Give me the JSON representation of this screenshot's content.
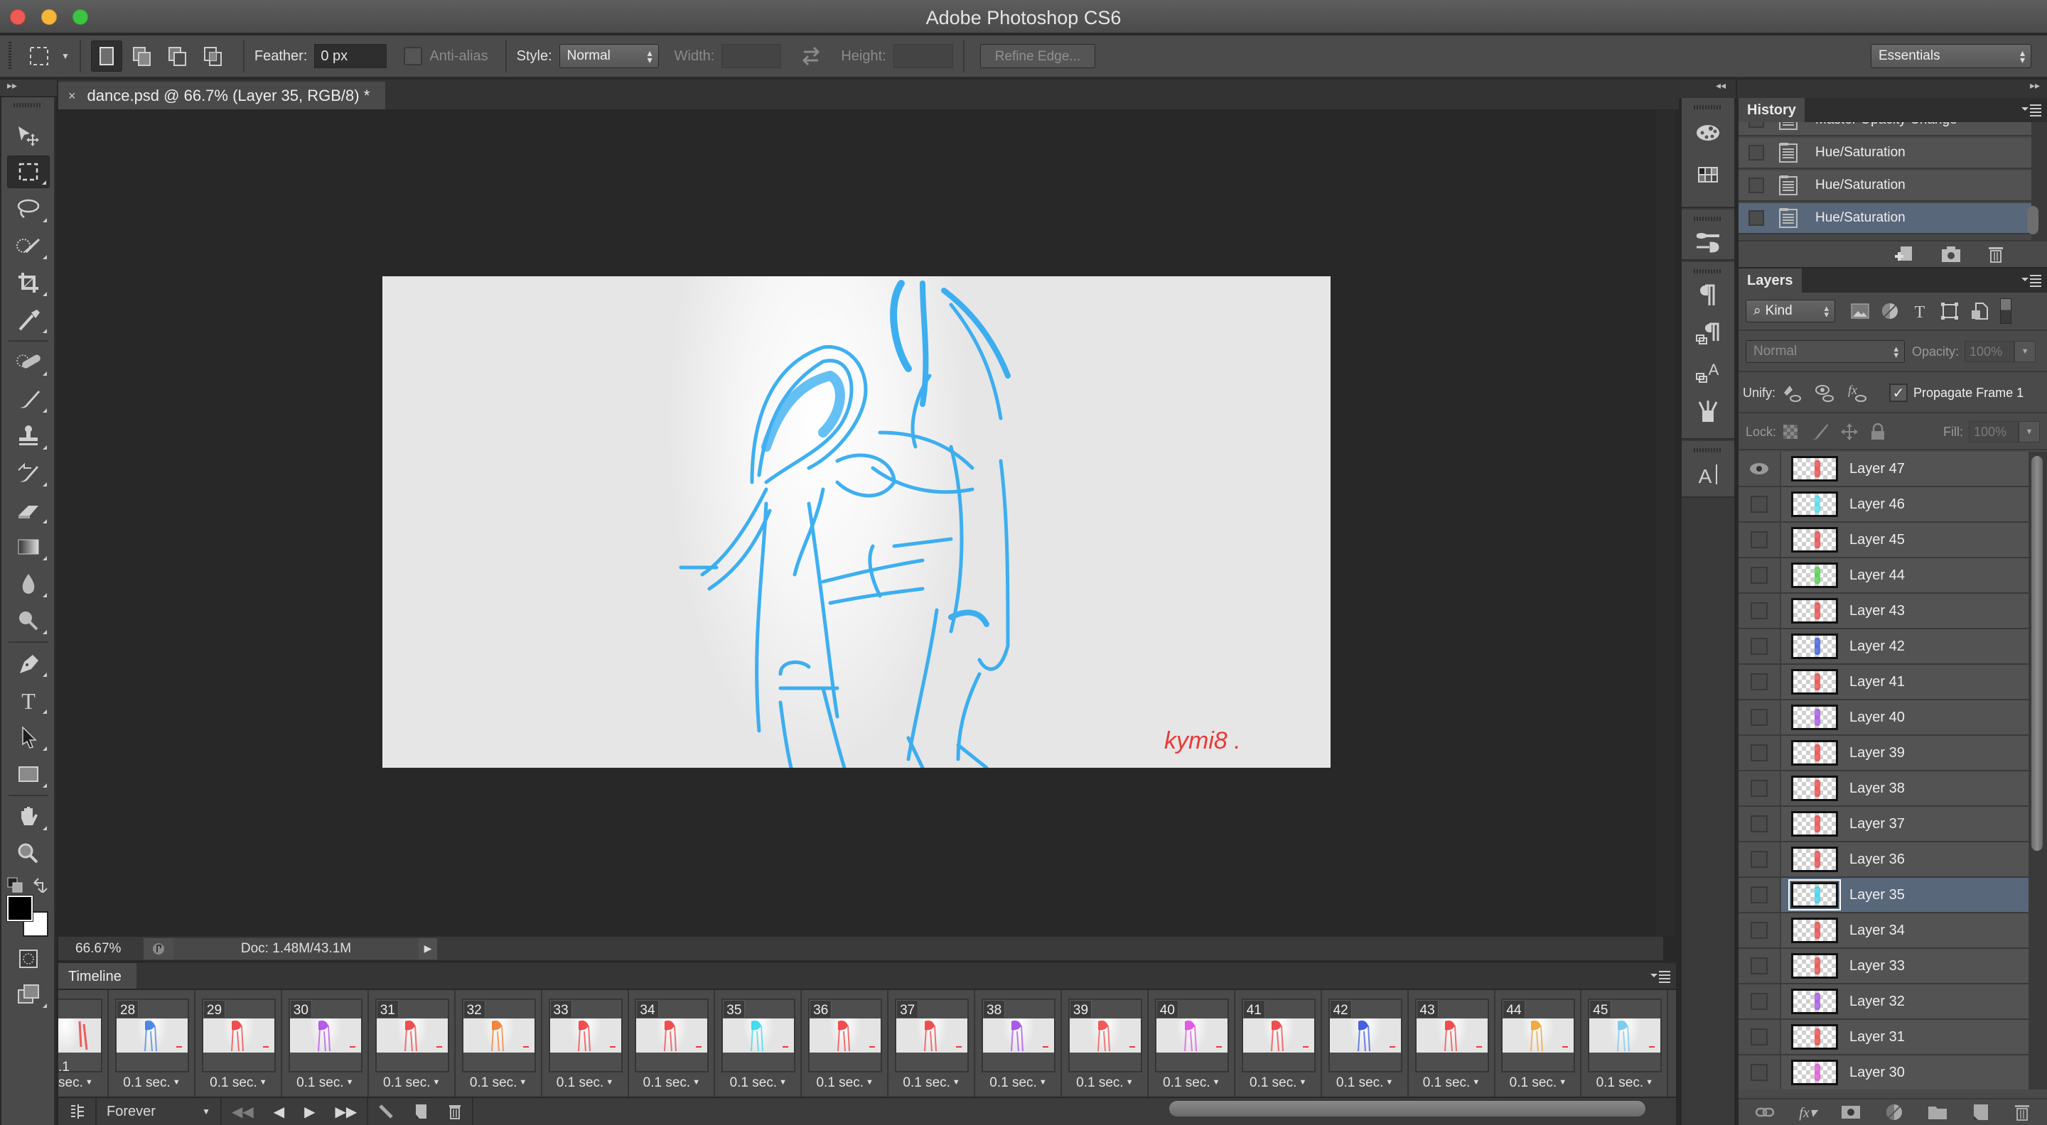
{
  "app": {
    "title": "Adobe Photoshop CS6"
  },
  "options_bar": {
    "feather_label": "Feather:",
    "feather_value": "0 px",
    "antialias_label": "Anti-alias",
    "antialias_checked": false,
    "style_label": "Style:",
    "style_value": "Normal",
    "width_label": "Width:",
    "width_value": "",
    "height_label": "Height:",
    "height_value": "",
    "refine_edge_label": "Refine Edge...",
    "workspace_value": "Essentials"
  },
  "document": {
    "tab_close": "×",
    "tab_title": "dance.psd @ 66.7% (Layer 35, RGB/8) *"
  },
  "canvas": {
    "signature": "kymi8 ."
  },
  "tools": [
    {
      "name": "move-tool-icon"
    },
    {
      "name": "rectangular-marquee-tool-icon",
      "active": true
    },
    {
      "name": "lasso-tool-icon"
    },
    {
      "name": "quick-selection-tool-icon"
    },
    {
      "name": "crop-tool-icon"
    },
    {
      "name": "eyedropper-tool-icon"
    },
    {
      "name": "spot-healing-brush-tool-icon"
    },
    {
      "name": "brush-tool-icon"
    },
    {
      "name": "clone-stamp-tool-icon"
    },
    {
      "name": "history-brush-tool-icon"
    },
    {
      "name": "eraser-tool-icon"
    },
    {
      "name": "gradient-tool-icon"
    },
    {
      "name": "blur-tool-icon"
    },
    {
      "name": "dodge-tool-icon"
    },
    {
      "name": "pen-tool-icon"
    },
    {
      "name": "type-tool-icon"
    },
    {
      "name": "path-selection-tool-icon"
    },
    {
      "name": "rectangle-tool-icon"
    },
    {
      "name": "hand-tool-icon"
    },
    {
      "name": "zoom-tool-icon"
    }
  ],
  "colors": {
    "foreground": "#000000",
    "background": "#ffffff",
    "selection_highlight": "#58677a",
    "sketch_stroke": "#2aa8f0",
    "signature_color": "#e83a3a"
  },
  "status_bar": {
    "zoom": "66.67%",
    "doc_info": "Doc: 1.48M/43.1M"
  },
  "timeline": {
    "tab_label": "Timeline",
    "loop_option": "Forever",
    "partial_frame_duration": ".1 sec.",
    "frames": [
      {
        "number": "28",
        "duration": "0.1 sec.",
        "color": "#3b7be8"
      },
      {
        "number": "29",
        "duration": "0.1 sec.",
        "color": "#ee3b3b"
      },
      {
        "number": "30",
        "duration": "0.1 sec.",
        "color": "#b048e8"
      },
      {
        "number": "31",
        "duration": "0.1 sec.",
        "color": "#ee3b3b"
      },
      {
        "number": "32",
        "duration": "0.1 sec.",
        "color": "#f07a2a"
      },
      {
        "number": "33",
        "duration": "0.1 sec.",
        "color": "#ee3b3b"
      },
      {
        "number": "34",
        "duration": "0.1 sec.",
        "color": "#ee3b3b"
      },
      {
        "number": "35",
        "duration": "0.1 sec.",
        "color": "#30d8f0"
      },
      {
        "number": "36",
        "duration": "0.1 sec.",
        "color": "#ee3b3b"
      },
      {
        "number": "37",
        "duration": "0.1 sec.",
        "color": "#ee3b3b"
      },
      {
        "number": "38",
        "duration": "0.1 sec.",
        "color": "#a048e8"
      },
      {
        "number": "39",
        "duration": "0.1 sec.",
        "color": "#ee4848"
      },
      {
        "number": "40",
        "duration": "0.1 sec.",
        "color": "#e048e0"
      },
      {
        "number": "41",
        "duration": "0.1 sec.",
        "color": "#ee3b3b"
      },
      {
        "number": "42",
        "duration": "0.1 sec.",
        "color": "#3050e0"
      },
      {
        "number": "43",
        "duration": "0.1 sec.",
        "color": "#ee3b3b"
      },
      {
        "number": "44",
        "duration": "0.1 sec.",
        "color": "#f0a030"
      },
      {
        "number": "45",
        "duration": "0.1 sec.",
        "color": "#70c8f0"
      }
    ]
  },
  "history": {
    "tab_label": "History",
    "items": [
      {
        "label": "Master Opacity Change",
        "selected": false
      },
      {
        "label": "Hue/Saturation",
        "selected": false
      },
      {
        "label": "Hue/Saturation",
        "selected": false
      },
      {
        "label": "Hue/Saturation",
        "selected": true
      }
    ]
  },
  "layers": {
    "tab_label": "Layers",
    "filter_kind": "Kind",
    "blend_mode": "Normal",
    "opacity_label": "Opacity:",
    "opacity_value": "100%",
    "unify_label": "Unify:",
    "propagate_label": "Propagate Frame 1",
    "propagate_checked": true,
    "lock_label": "Lock:",
    "fill_label": "Fill:",
    "fill_value": "100%",
    "items": [
      {
        "name": "Layer 47",
        "visible": true,
        "selected": false,
        "color": "#ee3b3b"
      },
      {
        "name": "Layer 46",
        "visible": false,
        "selected": false,
        "color": "#40e0f0"
      },
      {
        "name": "Layer 45",
        "visible": false,
        "selected": false,
        "color": "#ee3b3b"
      },
      {
        "name": "Layer 44",
        "visible": false,
        "selected": false,
        "color": "#40d040"
      },
      {
        "name": "Layer 43",
        "visible": false,
        "selected": false,
        "color": "#ee3b3b"
      },
      {
        "name": "Layer 42",
        "visible": false,
        "selected": false,
        "color": "#3050e0"
      },
      {
        "name": "Layer 41",
        "visible": false,
        "selected": false,
        "color": "#ee3b3b"
      },
      {
        "name": "Layer 40",
        "visible": false,
        "selected": false,
        "color": "#a048e8"
      },
      {
        "name": "Layer 39",
        "visible": false,
        "selected": false,
        "color": "#ee3b3b"
      },
      {
        "name": "Layer 38",
        "visible": false,
        "selected": false,
        "color": "#ee3b3b"
      },
      {
        "name": "Layer 37",
        "visible": false,
        "selected": false,
        "color": "#ee3b3b"
      },
      {
        "name": "Layer 36",
        "visible": false,
        "selected": false,
        "color": "#ee3b3b"
      },
      {
        "name": "Layer 35",
        "visible": false,
        "selected": true,
        "color": "#30d0f0"
      },
      {
        "name": "Layer 34",
        "visible": false,
        "selected": false,
        "color": "#ee3b3b"
      },
      {
        "name": "Layer 33",
        "visible": false,
        "selected": false,
        "color": "#ee3b3b"
      },
      {
        "name": "Layer 32",
        "visible": false,
        "selected": false,
        "color": "#a048e8"
      },
      {
        "name": "Layer 31",
        "visible": false,
        "selected": false,
        "color": "#ee3b3b"
      },
      {
        "name": "Layer 30",
        "visible": false,
        "selected": false,
        "color": "#e048d0"
      }
    ]
  }
}
